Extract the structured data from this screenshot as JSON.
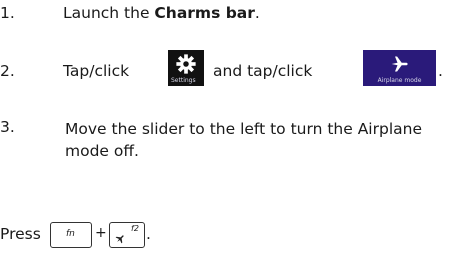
{
  "steps": [
    {
      "number": "1.",
      "text_before": "Launch the ",
      "bold": "Charms bar",
      "text_after": "."
    },
    {
      "number": "2.",
      "text_a": "Tap/click",
      "text_b": "and tap/click",
      "text_end": "."
    },
    {
      "number": "3.",
      "text": "Move the slider to the left to turn the Airplane mode off."
    }
  ],
  "tiles": {
    "settings": {
      "icon": "gear-icon",
      "caption": "Settings"
    },
    "airplane": {
      "icon": "airplane-icon",
      "caption": "Airplane mode"
    }
  },
  "shortcut": {
    "prefix": "Press",
    "plus": "+",
    "suffix": ".",
    "key1": "fn",
    "key2_label": "f2",
    "key2_icon": "airplane-icon"
  },
  "colors": {
    "settings_tile_bg": "#111111",
    "airplane_tile_bg": "#2a1a7a"
  }
}
